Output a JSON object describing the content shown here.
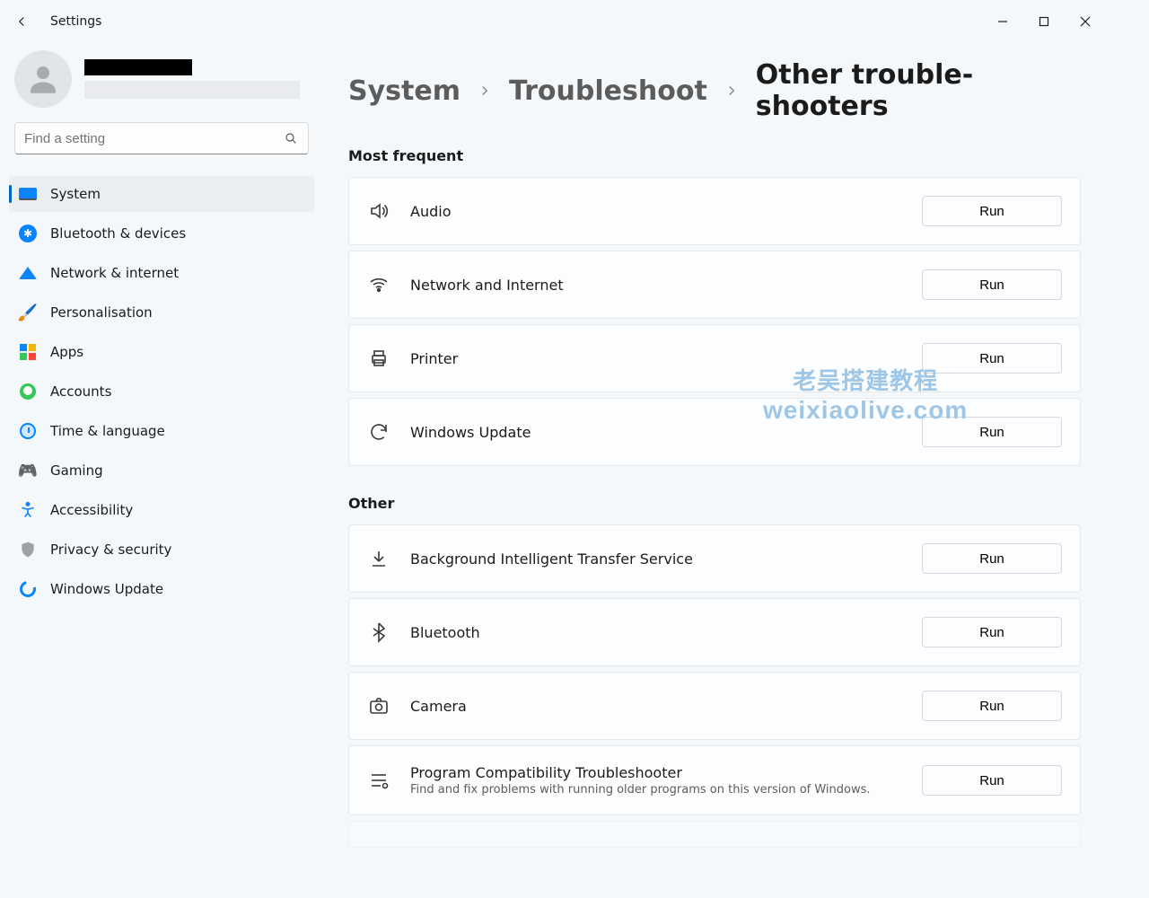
{
  "window_title": "Settings",
  "search_placeholder": "Find a setting",
  "breadcrumbs": {
    "system": "System",
    "troubleshoot": "Troubleshoot",
    "current": "Other trouble-shooters"
  },
  "sidebar": {
    "items": [
      {
        "label": "System"
      },
      {
        "label": "Bluetooth & devices"
      },
      {
        "label": "Network & internet"
      },
      {
        "label": "Personalisation"
      },
      {
        "label": "Apps"
      },
      {
        "label": "Accounts"
      },
      {
        "label": "Time & language"
      },
      {
        "label": "Gaming"
      },
      {
        "label": "Accessibility"
      },
      {
        "label": "Privacy & security"
      },
      {
        "label": "Windows Update"
      }
    ]
  },
  "sections": {
    "most_frequent": {
      "title": "Most frequent",
      "items": [
        {
          "title": "Audio",
          "run": "Run"
        },
        {
          "title": "Network and Internet",
          "run": "Run"
        },
        {
          "title": "Printer",
          "run": "Run"
        },
        {
          "title": "Windows Update",
          "run": "Run"
        }
      ]
    },
    "other": {
      "title": "Other",
      "items": [
        {
          "title": "Background Intelligent Transfer Service",
          "run": "Run"
        },
        {
          "title": "Bluetooth",
          "run": "Run"
        },
        {
          "title": "Camera",
          "run": "Run"
        },
        {
          "title": "Program Compatibility Troubleshooter",
          "sub": "Find and fix problems with running older programs on this version of Windows.",
          "run": "Run"
        }
      ]
    }
  },
  "watermark": {
    "line1": "老吴搭建教程",
    "line2": "weixiaolive.com"
  }
}
